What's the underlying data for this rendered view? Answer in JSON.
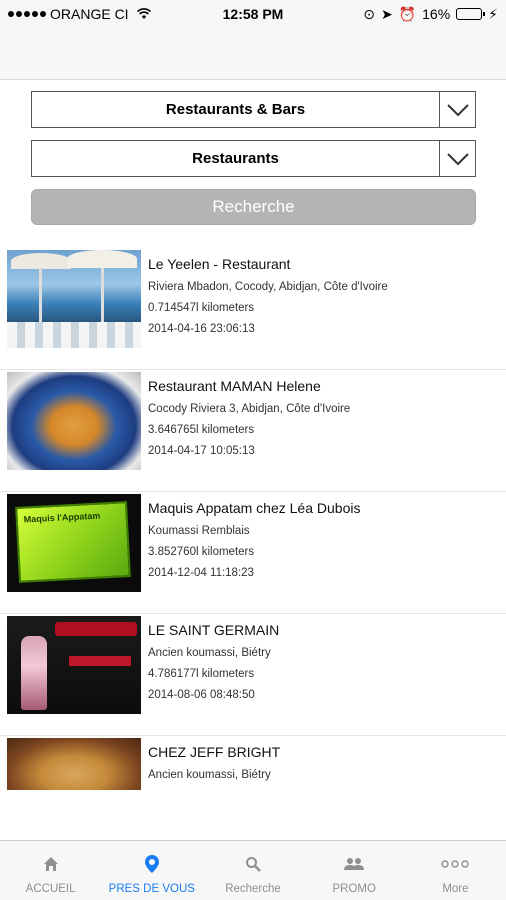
{
  "status_bar": {
    "carrier": "ORANGE CI",
    "time": "12:58 PM",
    "battery_percent": "16%",
    "battery_level": 0.16
  },
  "filters": {
    "category": "Restaurants & Bars",
    "subcategory": "Restaurants",
    "search_button": "Recherche"
  },
  "results": [
    {
      "name": "Le Yeelen - Restaurant",
      "address": "Riviera Mbadon, Cocody, Abidjan, Côte d'Ivoire",
      "distance": "0.714547l kilometers",
      "date": "2014-04-16 23:06:13"
    },
    {
      "name": "Restaurant MAMAN Helene",
      "address": "Cocody Riviera 3, Abidjan, Côte d'Ivoire",
      "distance": "3.646765l kilometers",
      "date": "2014-04-17 10:05:13"
    },
    {
      "name": "Maquis Appatam chez Léa Dubois",
      "address": "Koumassi Remblais",
      "distance": "3.852760l kilometers",
      "date": "2014-12-04 11:18:23"
    },
    {
      "name": "LE SAINT GERMAIN",
      "address": "Ancien koumassi, Biétry",
      "distance": "4.786177l kilometers",
      "date": "2014-08-06 08:48:50"
    },
    {
      "name": "CHEZ JEFF BRIGHT",
      "address": "Ancien koumassi, Biétry"
    }
  ],
  "tabs": [
    {
      "label": "ACCUEIL",
      "icon": "home-icon"
    },
    {
      "label": "PRES DE VOUS",
      "icon": "location-pin-icon",
      "active": true
    },
    {
      "label": "Recherche",
      "icon": "search-icon"
    },
    {
      "label": "PROMO",
      "icon": "people-icon"
    },
    {
      "label": "More",
      "icon": "more-icon"
    }
  ],
  "colors": {
    "active_tab": "#1a7cf2",
    "inactive_tab": "#8e8e93",
    "search_button": "#b4b4b4"
  }
}
